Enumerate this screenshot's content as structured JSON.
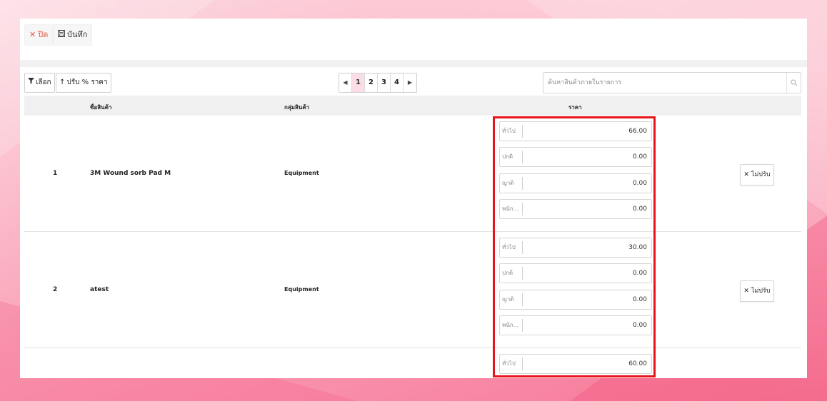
{
  "toolbar": {
    "close_label": "ปิด",
    "save_label": "บันทึก"
  },
  "actions": {
    "select_label": "เลือก",
    "adjust_label": "ปรับ % ราคา"
  },
  "pagination": {
    "pages": [
      "1",
      "2",
      "3",
      "4"
    ],
    "current": "1"
  },
  "search": {
    "placeholder": "ค้นหาสินค้าภายในรายการ"
  },
  "table": {
    "headers": {
      "name": "ชื่อสินค้า",
      "group": "กลุ่มสินค้า",
      "price": "ราคา"
    },
    "rows": [
      {
        "no": "1",
        "name": "3M Wound sorb Pad M",
        "group": "Equipment",
        "prices": [
          {
            "label": "ทั่วไป",
            "value": "66.00"
          },
          {
            "label": "ปกติ",
            "value": "0.00"
          },
          {
            "label": "ญาติ",
            "value": "0.00"
          },
          {
            "label": "พนัก...",
            "value": "0.00"
          }
        ],
        "action": "ไม่ปรับ"
      },
      {
        "no": "2",
        "name": "atest",
        "group": "Equipment",
        "prices": [
          {
            "label": "ทั่วไป",
            "value": "30.00"
          },
          {
            "label": "ปกติ",
            "value": "0.00"
          },
          {
            "label": "ญาติ",
            "value": "0.00"
          },
          {
            "label": "พนัก...",
            "value": "0.00"
          }
        ],
        "action": "ไม่ปรับ"
      },
      {
        "prices": [
          {
            "label": "ทั่วไป",
            "value": "60.00"
          }
        ]
      }
    ]
  },
  "colors": {
    "accent_pink": "#fbdde6",
    "close_red": "#e0594a",
    "highlight_red": "#e8141c"
  },
  "icons": {
    "close": "x-icon",
    "save": "save-icon",
    "filter": "filter-icon",
    "adjust": "arrow-up-icon",
    "search": "search-icon",
    "remove": "x-icon"
  }
}
